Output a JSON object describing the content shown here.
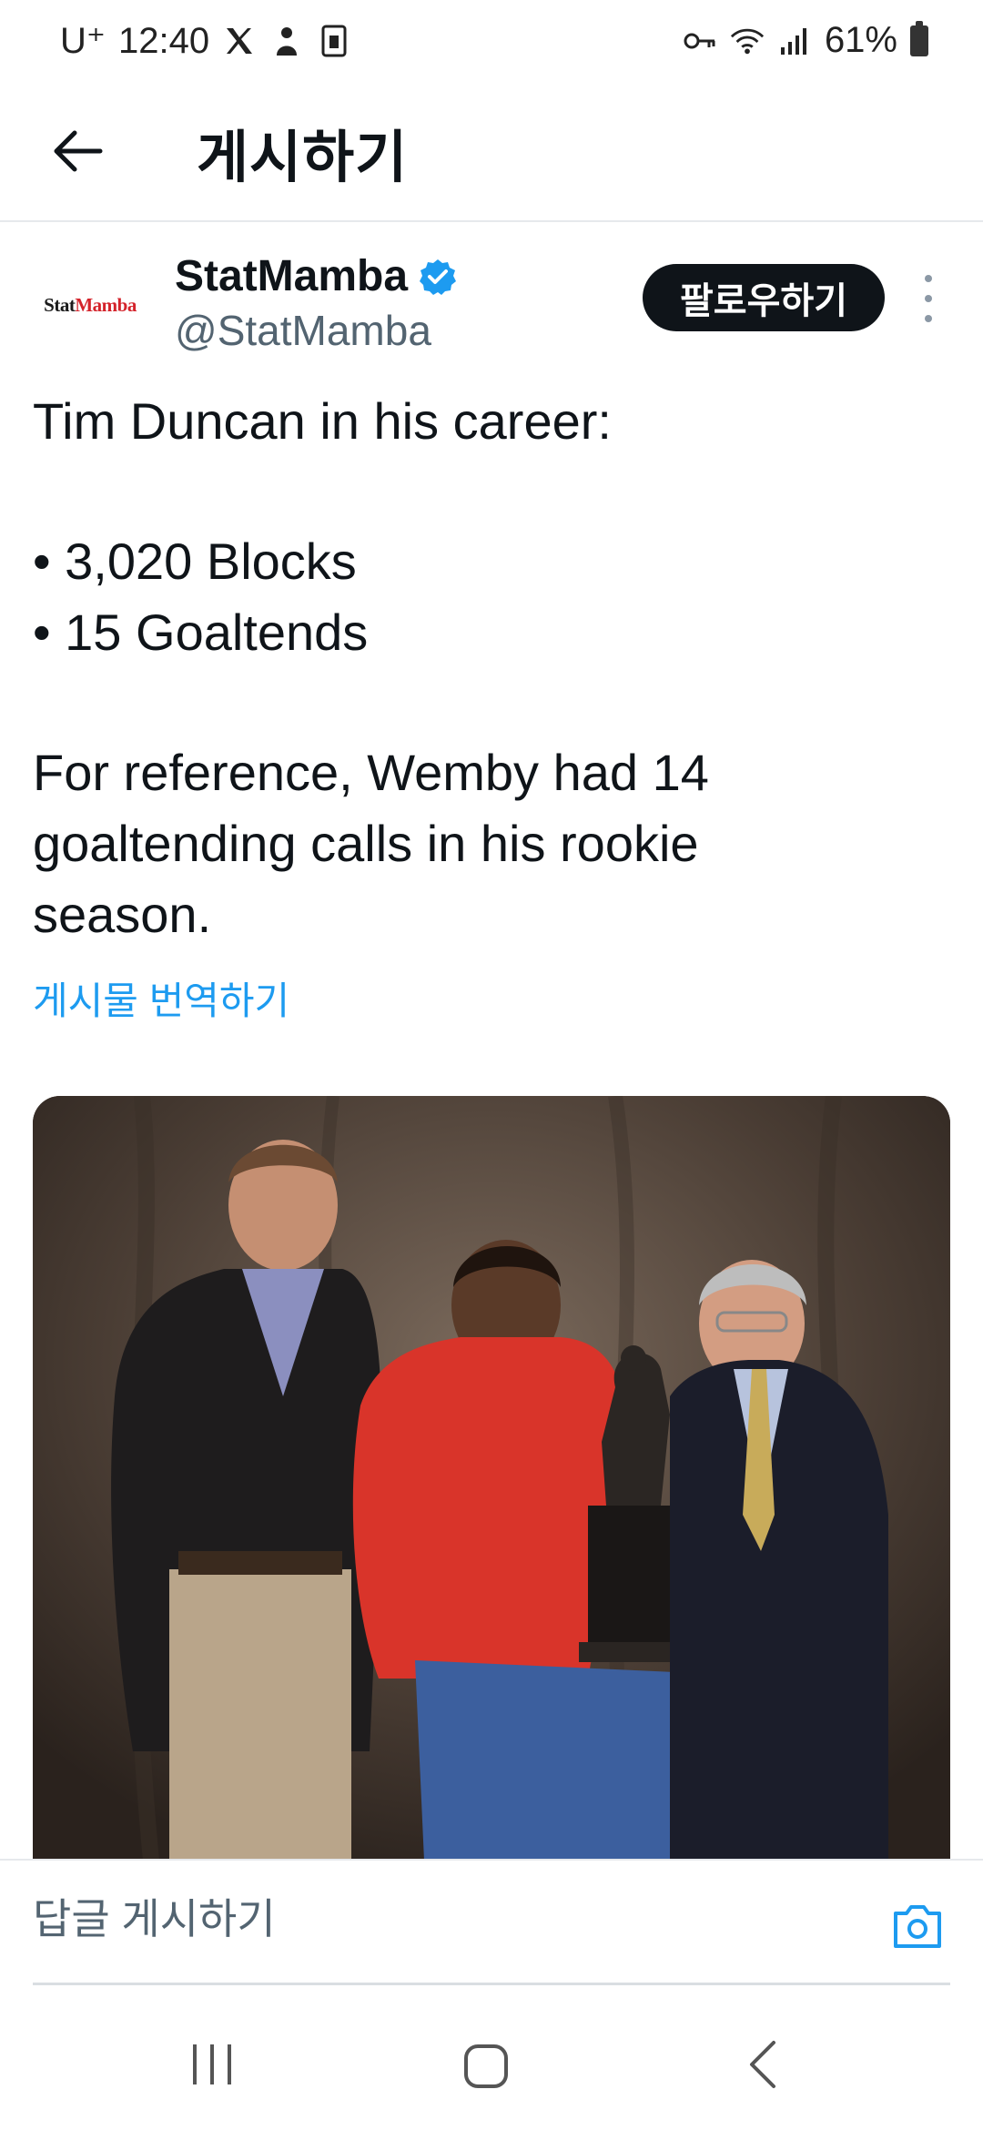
{
  "status_bar": {
    "carrier": "U⁺",
    "time": "12:40",
    "battery": "61%",
    "left_icons": [
      "x-logo-icon",
      "bixby-icon",
      "sim-icon"
    ],
    "right_icons": [
      "key-icon",
      "wifi-icon",
      "signal-icon",
      "battery-icon"
    ]
  },
  "header": {
    "title": "게시하기",
    "back_icon": "arrow-left-icon"
  },
  "post": {
    "avatar_text_1": "Stat",
    "avatar_text_2": "Mamba",
    "author_name": "StatMamba",
    "handle": "@StatMamba",
    "follow_label": "팔로우하기",
    "lines": [
      "Tim Duncan in his career:",
      "• 3,020 Blocks",
      "• 15 Goaltends",
      "For reference, Wemby had 14",
      "goaltending calls in his rookie",
      "season."
    ],
    "translate_label": "게시물 번역하기"
  },
  "reply_bar": {
    "placeholder": "답글 게시하기",
    "camera_icon": "camera-icon"
  },
  "nav_bar": {
    "icons": [
      "recent-apps-icon",
      "home-icon",
      "back-icon"
    ]
  },
  "colors": {
    "accent": "#1d9bf0",
    "text": "#0f1419",
    "secondary": "#536471",
    "follow_bg": "#0f1419"
  }
}
